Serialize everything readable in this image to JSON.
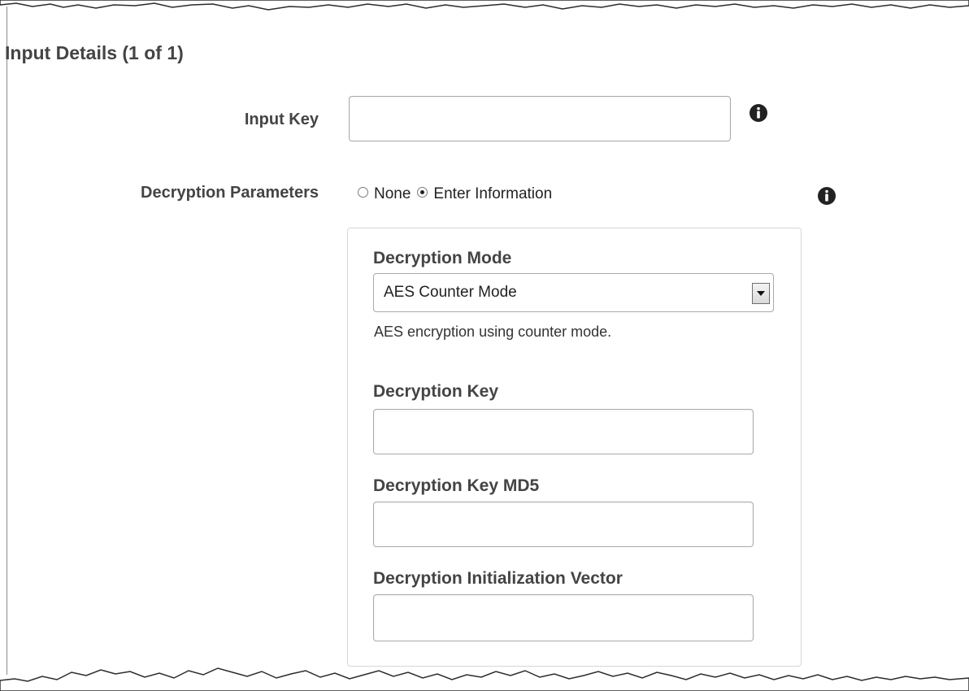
{
  "section": {
    "title": "Input Details (1 of 1)"
  },
  "input_key": {
    "label": "Input Key",
    "value": ""
  },
  "decryption_parameters": {
    "label": "Decryption Parameters",
    "options": [
      {
        "label": "None",
        "selected": false
      },
      {
        "label": "Enter Information",
        "selected": true
      }
    ]
  },
  "decryption_mode": {
    "label": "Decryption Mode",
    "selected_value": "AES Counter Mode",
    "help_text": "AES encryption using counter mode."
  },
  "decryption_key": {
    "label": "Decryption Key",
    "value": ""
  },
  "decryption_key_md5": {
    "label": "Decryption Key MD5",
    "value": ""
  },
  "decryption_iv": {
    "label": "Decryption Initialization Vector",
    "value": ""
  },
  "icons": {
    "info": "info-icon"
  },
  "colors": {
    "label_text": "#444444",
    "border": "#a9a9a9",
    "info_icon": "#222222",
    "panel_border": "#d6d6d6"
  }
}
